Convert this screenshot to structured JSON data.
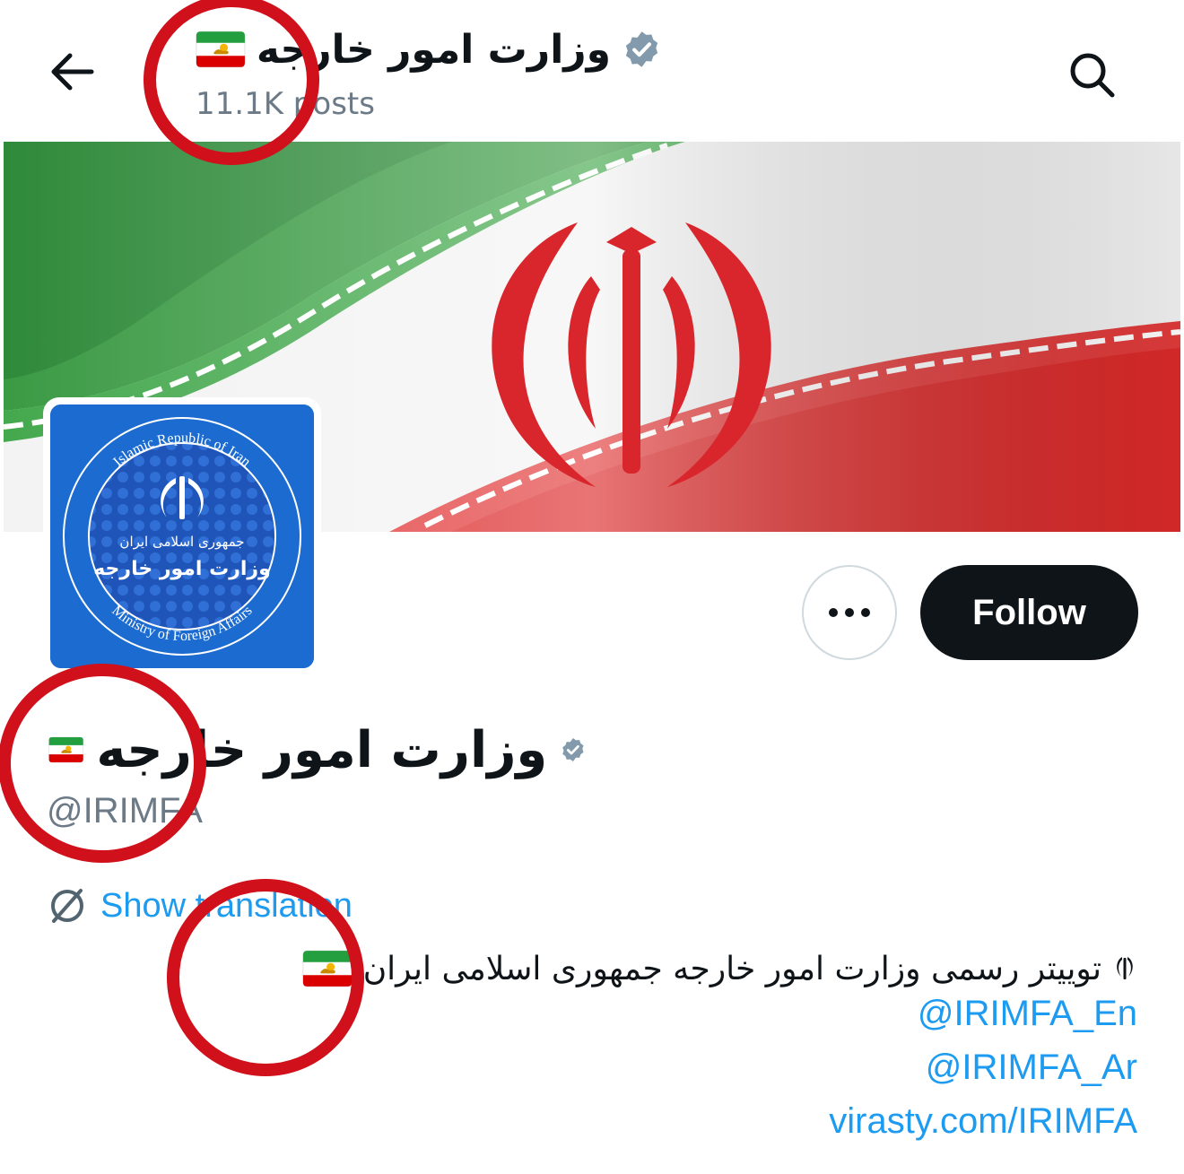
{
  "header": {
    "title": "وزارت امور خارجه",
    "posts": "11.1K posts"
  },
  "profile": {
    "display_name": "وزارت امور خارجه",
    "handle": "@IRIMFA",
    "follow_label": "Follow",
    "show_translation": "Show translation",
    "bio": "تویيتر رسمی وزارت امور خارجه جمهوری اسلامی ایران",
    "links": [
      "@IRIMFA_En",
      "@IRIMFA_Ar",
      "virasty.com/IRIMFA"
    ],
    "avatar": {
      "ring_top": "Islamic Republic of Iran",
      "ring_bottom": "Ministry of Foreign Affairs",
      "center_small": "جمهوری اسلامی ایران",
      "center_large": "وزارت امور خارجه"
    }
  },
  "colors": {
    "verified_badge": "#829aab",
    "link": "#1d9bf0",
    "follow_bg": "#0f1419",
    "annotation_circle": "#d0101a",
    "flag_green": "#239f40",
    "flag_red": "#da0000"
  },
  "icons": [
    "back-arrow-icon",
    "search-icon",
    "verified-badge-icon",
    "more-options-icon",
    "translate-icon",
    "lion-sun-flag-icon",
    "iran-emblem-icon"
  ]
}
